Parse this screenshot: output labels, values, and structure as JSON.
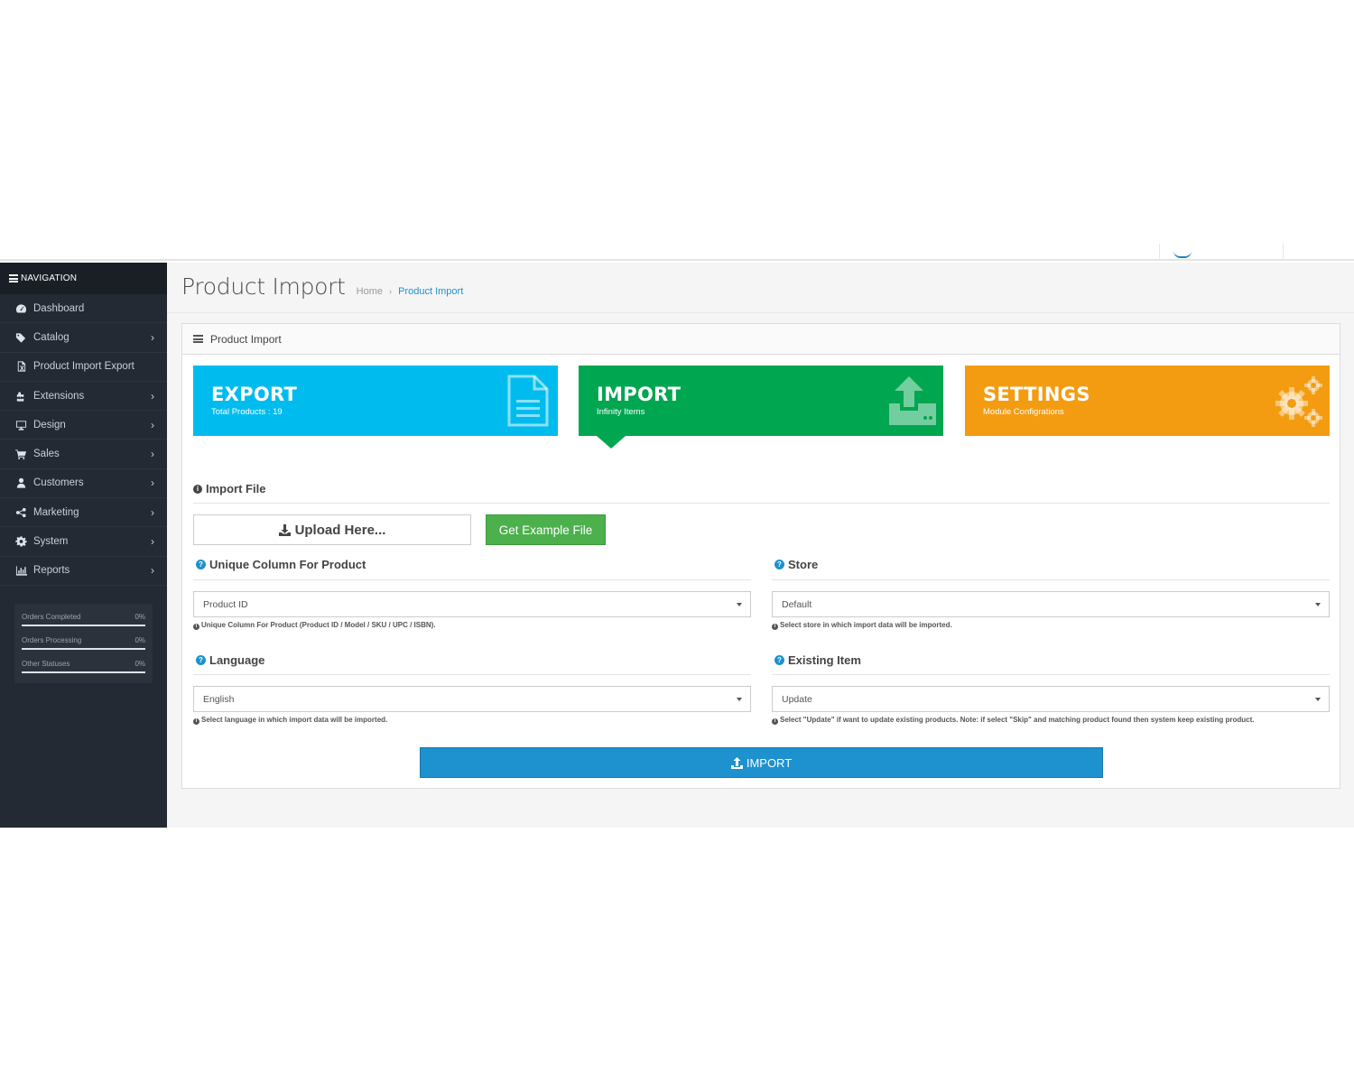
{
  "sidebar": {
    "heading": "NAVIGATION",
    "items": [
      {
        "label": "Dashboard",
        "icon": "dashboard-icon",
        "has_children": false
      },
      {
        "label": "Catalog",
        "icon": "tags-icon",
        "has_children": true
      },
      {
        "label": "Product Import Export",
        "icon": "file-excel-icon",
        "has_children": false
      },
      {
        "label": "Extensions",
        "icon": "puzzle-icon",
        "has_children": true
      },
      {
        "label": "Design",
        "icon": "desktop-icon",
        "has_children": true
      },
      {
        "label": "Sales",
        "icon": "cart-icon",
        "has_children": true
      },
      {
        "label": "Customers",
        "icon": "user-icon",
        "has_children": true
      },
      {
        "label": "Marketing",
        "icon": "share-icon",
        "has_children": true
      },
      {
        "label": "System",
        "icon": "cog-icon",
        "has_children": true
      },
      {
        "label": "Reports",
        "icon": "bar-chart-icon",
        "has_children": true
      }
    ],
    "stats": [
      {
        "label": "Orders Completed",
        "value": "0%",
        "progress": 0
      },
      {
        "label": "Orders Processing",
        "value": "0%",
        "progress": 0
      },
      {
        "label": "Other Statuses",
        "value": "0%",
        "progress": 0
      }
    ]
  },
  "header": {
    "title": "Product Import",
    "breadcrumb": [
      "Home",
      "Product Import"
    ],
    "breadcrumb_sep": "›"
  },
  "panel": {
    "title": "Product Import",
    "tiles": [
      {
        "title": "EXPORT",
        "subtitle": "Total Products : 19",
        "icon": "file-icon",
        "color": "#00bcee"
      },
      {
        "title": "IMPORT",
        "subtitle": "Infinity Items",
        "icon": "upload-icon",
        "color": "#00a650",
        "active": true
      },
      {
        "title": "SETTINGS",
        "subtitle": "Module Configrations",
        "icon": "cogs-icon",
        "color": "#f39c12"
      }
    ],
    "import_file": {
      "title": "Import File",
      "upload_label": "Upload Here...",
      "example_label": "Get Example File"
    },
    "unique_column": {
      "title": "Unique Column For Product",
      "value": "Product ID",
      "help": "Unique Column For Product (Product ID / Model / SKU / UPC / ISBN)."
    },
    "store": {
      "title": "Store",
      "value": "Default",
      "help": "Select store in which import data will be imported."
    },
    "language": {
      "title": "Language",
      "value": "English",
      "help": "Select language in which import data will be imported."
    },
    "existing_item": {
      "title": "Existing Item",
      "value": "Update",
      "help": "Select \"Update\" if want to update existing products. Note: if select \"Skip\" and matching product found then system keep existing product."
    },
    "import_button": "IMPORT"
  },
  "colors": {
    "sidebar_bg": "#232a33",
    "primary": "#1e91cf",
    "success": "#4cb04c"
  }
}
